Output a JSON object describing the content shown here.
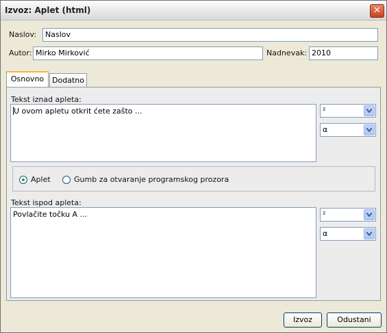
{
  "window": {
    "title": "Izvoz: Aplet (html)",
    "close_glyph": "✕"
  },
  "form": {
    "title_label": "Naslov:",
    "title_value": "Naslov",
    "author_label": "Autor:",
    "author_value": "Mirko Mirković",
    "date_label": "Nadnevak:",
    "date_value": "2010"
  },
  "tabs": [
    {
      "label": "Osnovno",
      "active": true
    },
    {
      "label": "Dodatno",
      "active": false
    }
  ],
  "main": {
    "text_above_label": "Tekst iznad apleta:",
    "text_above_value": "U ovom apletu otkrit ćete zašto ...",
    "combo_above_1": "²",
    "combo_above_2": "α",
    "radio_applet_label": "Aplet",
    "radio_button_label": "Gumb za otvaranje programskog prozora",
    "selected_option": "Aplet",
    "text_below_label": "Tekst ispod apleta:",
    "text_below_value": "Povlačite točku A ...",
    "combo_below_1": "²",
    "combo_below_2": "α"
  },
  "buttons": {
    "export": "Izvoz",
    "cancel": "Odustani"
  },
  "colors": {
    "tab_active_accent": "#f4b53f",
    "close_button": "#c8421d",
    "radio_dot": "#21a121"
  }
}
